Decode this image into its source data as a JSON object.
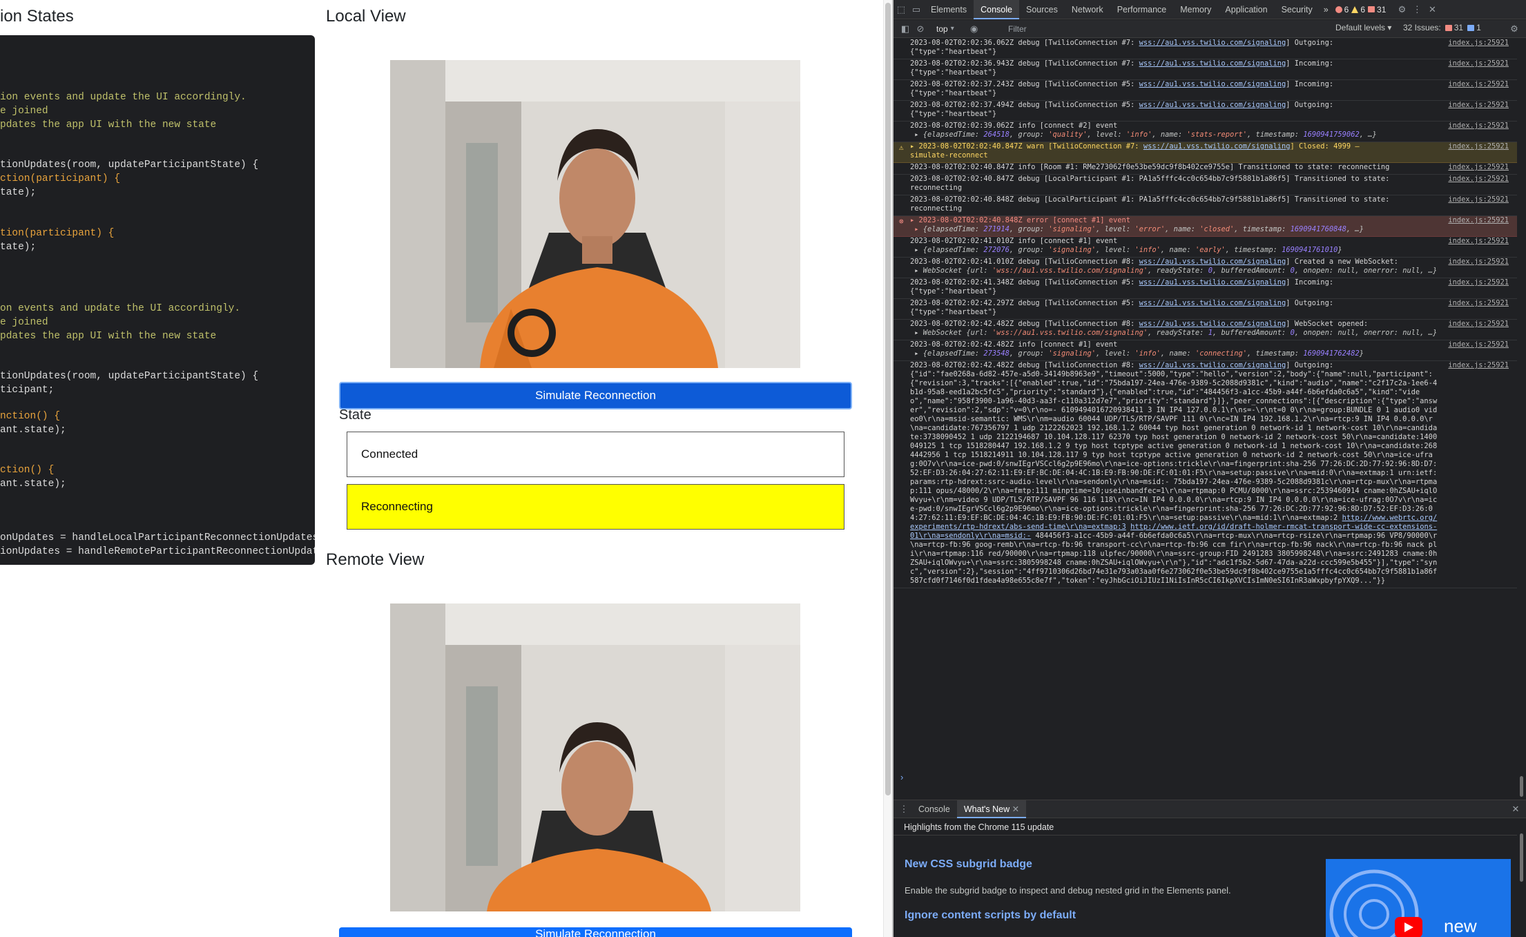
{
  "page": {
    "section_title_left": "ion States",
    "local_view_title": "Local View",
    "remote_view_title": "Remote View",
    "simulate_button_label": "Simulate Reconnection",
    "simulate_button_label_cut": "Simulate Reconnection",
    "state_label": "State",
    "states": [
      "Connected",
      "Reconnecting"
    ],
    "state_colors": {
      "connected": "#ffffff",
      "reconnecting": "#ffff00"
    },
    "code_lines": [
      {
        "text": "ion events and update the UI accordingly.",
        "cls": "c-com"
      },
      {
        "text": "e joined",
        "cls": "c-com"
      },
      {
        "text": "pdates the app UI with the new state",
        "cls": "c-com"
      },
      {
        "text": "tionUpdates(room, updateParticipantState) {",
        "cls": "c-id"
      },
      {
        "text": "ction(participant) {",
        "cls": "c-fn"
      },
      {
        "text": "tate);",
        "cls": "c-id"
      },
      {
        "text": "tion(participant) {",
        "cls": "c-fn"
      },
      {
        "text": "tate);",
        "cls": "c-id"
      },
      {
        "text": "on events and update the UI accordingly.",
        "cls": "c-com"
      },
      {
        "text": "e joined",
        "cls": "c-com"
      },
      {
        "text": "pdates the app UI with the new state",
        "cls": "c-com"
      },
      {
        "text": "tionUpdates(room, updateParticipantState) {",
        "cls": "c-id"
      },
      {
        "text": "ticipant;",
        "cls": "c-id"
      },
      {
        "text": "nction() {",
        "cls": "c-fn"
      },
      {
        "text": "ant.state);",
        "cls": "c-id"
      },
      {
        "text": "ction() {",
        "cls": "c-fn"
      },
      {
        "text": "ant.state);",
        "cls": "c-id"
      },
      {
        "text": "onUpdates = handleLocalParticipantReconnectionUpdates;",
        "cls": "c-id"
      },
      {
        "text": "ionUpdates = handleRemoteParticipantReconnectionUpdates;",
        "cls": "c-id"
      }
    ]
  },
  "devtools": {
    "tabs": [
      "Elements",
      "Console",
      "Sources",
      "Network",
      "Performance",
      "Memory",
      "Application",
      "Security"
    ],
    "active_tab": "Console",
    "more_tabs": "»",
    "counts": {
      "errors": "6",
      "warnings": "6",
      "issues": "31"
    },
    "context": "top",
    "filter_placeholder": "Filter",
    "levels": "Default levels ▾",
    "issues_label": "32 Issues:",
    "issues_errors": "31",
    "issues_info": "1",
    "source_link": "index.js:25921",
    "prompt": "›",
    "drawer_tabs": [
      "Console",
      "What's New"
    ],
    "drawer_active": "What's New",
    "highlights": "Highlights from the Chrome 115 update",
    "news": [
      {
        "title": "New CSS subgrid badge",
        "desc": "Enable the subgrid badge to inspect and debug nested grid in the Elements panel."
      },
      {
        "title": "Ignore content scripts by default",
        "desc": ""
      }
    ],
    "thumb_text": "new"
  }
}
